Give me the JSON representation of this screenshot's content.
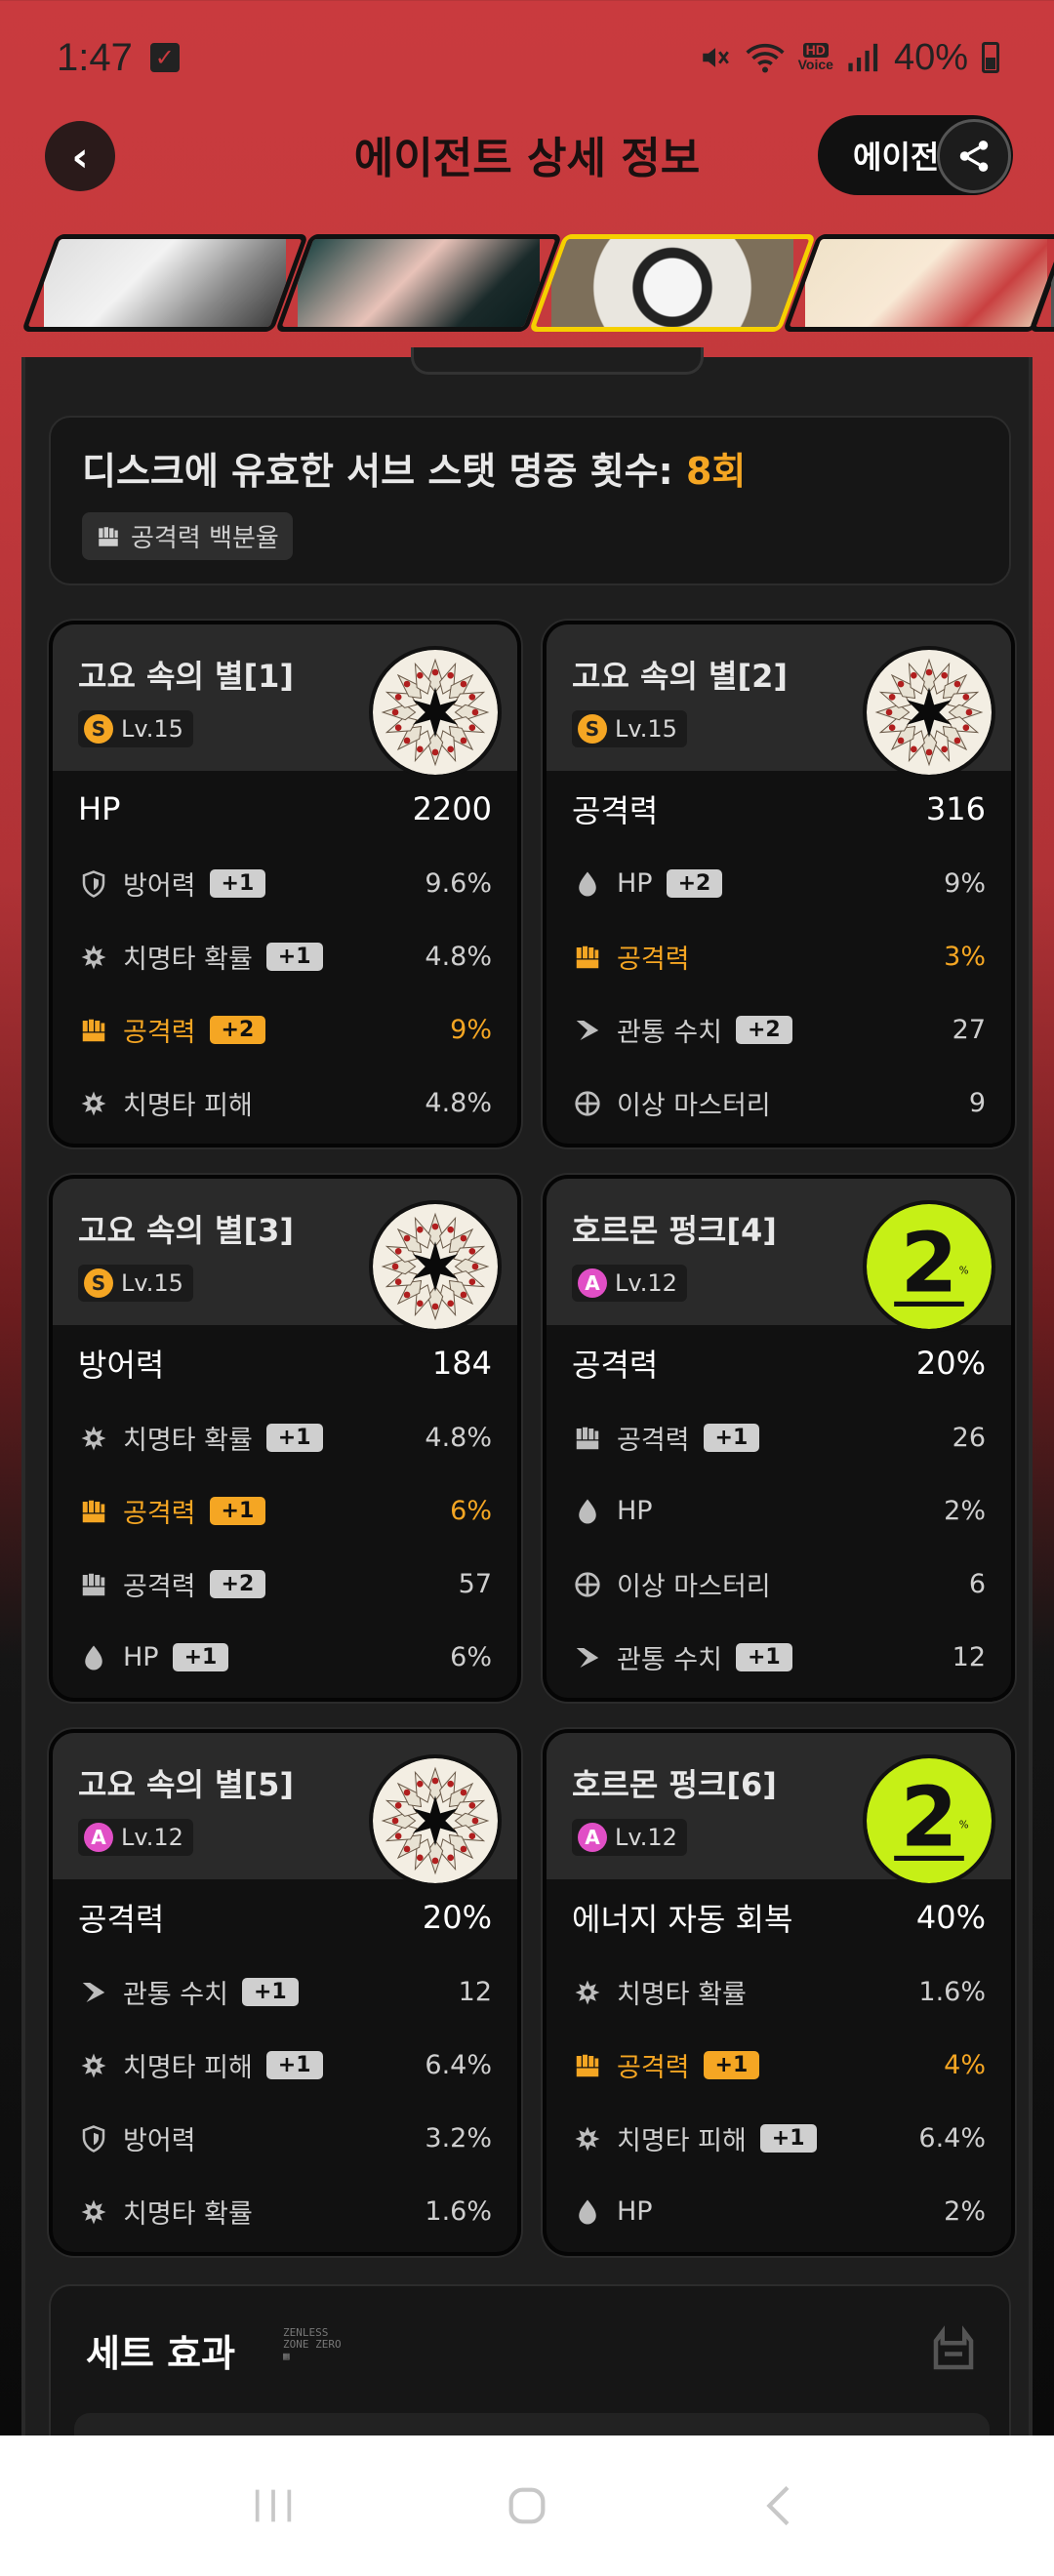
{
  "status_bar": {
    "time": "1:47",
    "battery": "40%",
    "hd_label": "HD",
    "voice_label": "Voice"
  },
  "header": {
    "title": "에이전트 상세 정보",
    "agent_pill": "에이전"
  },
  "hits": {
    "title_prefix": "디스크에 유효한 서브 스탯 명중 횟수: ",
    "count": "8회",
    "tag": "공격력 백분율"
  },
  "discs": [
    {
      "name": "고요 속의 별[1]",
      "rank": "S",
      "level": "Lv.15",
      "main_stat": "HP",
      "main_value": "2200",
      "subs": [
        {
          "icon": "shield-icon",
          "label": "방어력",
          "badge": "+1",
          "value": "9.6%",
          "highlight": false
        },
        {
          "icon": "crit-icon",
          "label": "치명타 확률",
          "badge": "+1",
          "value": "4.8%",
          "highlight": false
        },
        {
          "icon": "fist-icon",
          "label": "공격력",
          "badge": "+2",
          "value": "9%",
          "highlight": true
        },
        {
          "icon": "crit-icon",
          "label": "치명타 피해",
          "badge": "",
          "value": "4.8%",
          "highlight": false
        }
      ]
    },
    {
      "name": "고요 속의 별[2]",
      "rank": "S",
      "level": "Lv.15",
      "main_stat": "공격력",
      "main_value": "316",
      "subs": [
        {
          "icon": "drop-icon",
          "label": "HP",
          "badge": "+2",
          "value": "9%",
          "highlight": false
        },
        {
          "icon": "fist-icon",
          "label": "공격력",
          "badge": "",
          "value": "3%",
          "highlight": true
        },
        {
          "icon": "pierce-icon",
          "label": "관통 수치",
          "badge": "+2",
          "value": "27",
          "highlight": false
        },
        {
          "icon": "anomaly-icon",
          "label": "이상 마스터리",
          "badge": "",
          "value": "9",
          "highlight": false
        }
      ]
    },
    {
      "name": "고요 속의 별[3]",
      "rank": "S",
      "level": "Lv.15",
      "main_stat": "방어력",
      "main_value": "184",
      "subs": [
        {
          "icon": "crit-icon",
          "label": "치명타 확률",
          "badge": "+1",
          "value": "4.8%",
          "highlight": false
        },
        {
          "icon": "fist-icon",
          "label": "공격력",
          "badge": "+1",
          "value": "6%",
          "highlight": true
        },
        {
          "icon": "fist-icon",
          "label": "공격력",
          "badge": "+2",
          "value": "57",
          "highlight": false
        },
        {
          "icon": "drop-icon",
          "label": "HP",
          "badge": "+1",
          "value": "6%",
          "highlight": false
        }
      ]
    },
    {
      "name": "호르몬 펑크[4]",
      "rank": "A",
      "level": "Lv.12",
      "main_stat": "공격력",
      "main_value": "20%",
      "subs": [
        {
          "icon": "fist-icon",
          "label": "공격력",
          "badge": "+1",
          "value": "26",
          "highlight": false
        },
        {
          "icon": "drop-icon",
          "label": "HP",
          "badge": "",
          "value": "2%",
          "highlight": false
        },
        {
          "icon": "anomaly-icon",
          "label": "이상 마스터리",
          "badge": "",
          "value": "6",
          "highlight": false
        },
        {
          "icon": "pierce-icon",
          "label": "관통 수치",
          "badge": "+1",
          "value": "12",
          "highlight": false
        }
      ]
    },
    {
      "name": "고요 속의 별[5]",
      "rank": "A",
      "level": "Lv.12",
      "main_stat": "공격력",
      "main_value": "20%",
      "subs": [
        {
          "icon": "pierce-icon",
          "label": "관통 수치",
          "badge": "+1",
          "value": "12",
          "highlight": false
        },
        {
          "icon": "crit-icon",
          "label": "치명타 피해",
          "badge": "+1",
          "value": "6.4%",
          "highlight": false
        },
        {
          "icon": "shield-icon",
          "label": "방어력",
          "badge": "",
          "value": "3.2%",
          "highlight": false
        },
        {
          "icon": "crit-icon",
          "label": "치명타 확률",
          "badge": "",
          "value": "1.6%",
          "highlight": false
        }
      ]
    },
    {
      "name": "호르몬 펑크[6]",
      "rank": "A",
      "level": "Lv.12",
      "main_stat": "에너지 자동 회복",
      "main_value": "40%",
      "subs": [
        {
          "icon": "crit-icon",
          "label": "치명타 확률",
          "badge": "",
          "value": "1.6%",
          "highlight": false
        },
        {
          "icon": "fist-icon",
          "label": "공격력",
          "badge": "+1",
          "value": "4%",
          "highlight": true
        },
        {
          "icon": "crit-icon",
          "label": "치명타 피해",
          "badge": "+1",
          "value": "6.4%",
          "highlight": false
        },
        {
          "icon": "drop-icon",
          "label": "HP",
          "badge": "",
          "value": "2%",
          "highlight": false
        }
      ]
    }
  ],
  "set_effect": {
    "title": "세트 효과"
  },
  "colors": {
    "accent": "#f5a623",
    "header_bg": "#c93a3e",
    "card_bg": "#111111",
    "selected_portrait": "#f5d000",
    "hormone_disc": "#c6f016"
  }
}
